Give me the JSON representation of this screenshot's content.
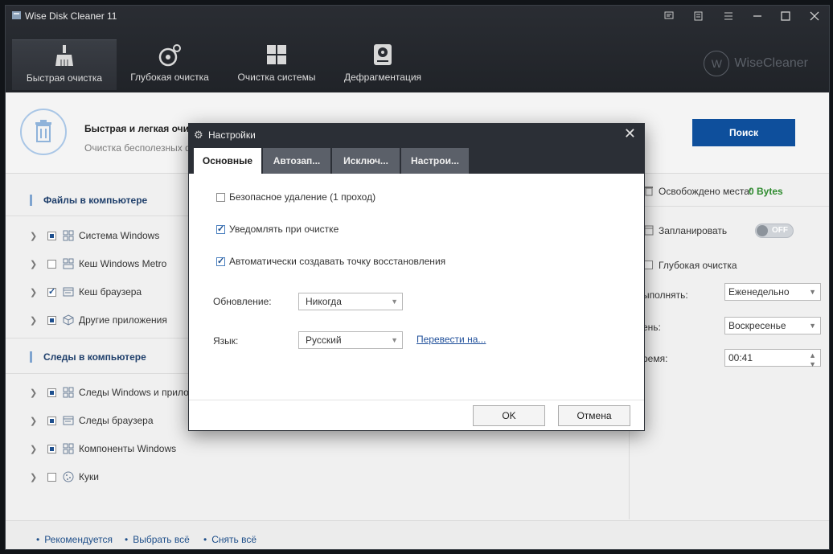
{
  "window": {
    "title": "Wise Disk Cleaner 11"
  },
  "titlebar_icons": [
    "feedback-icon",
    "notes-icon",
    "menu-icon",
    "minimize-icon",
    "maximize-icon",
    "close-icon"
  ],
  "nav": {
    "tabs": [
      {
        "label": "Быстрая очистка",
        "icon": "broom-icon"
      },
      {
        "label": "Глубокая очистка",
        "icon": "deep-clean-icon"
      },
      {
        "label": "Очистка системы",
        "icon": "windows-icon"
      },
      {
        "label": "Дефрагментация",
        "icon": "disk-icon"
      }
    ],
    "brand": "WiseCleaner",
    "brand_mark": "W"
  },
  "banner": {
    "title": "Быстрая и легкая очистка ненужных файлов и истори",
    "subtitle": "Очистка бесполезных фа",
    "scan_button": "Поиск"
  },
  "files_section": {
    "heading": "Файлы в компьютере",
    "items": [
      {
        "label": "Система Windows",
        "check": "partial"
      },
      {
        "label": "Кеш Windows Metro",
        "check": "none"
      },
      {
        "label": "Кеш браузера",
        "check": "checked"
      },
      {
        "label": "Другие приложения",
        "check": "partial"
      }
    ]
  },
  "traces_section": {
    "heading": "Следы в компьютере",
    "items": [
      {
        "label": "Следы Windows и приложен",
        "check": "partial"
      },
      {
        "label": "Следы браузера",
        "check": "partial"
      },
      {
        "label": "Компоненты Windows",
        "check": "partial"
      },
      {
        "label": "Куки",
        "check": "none"
      }
    ]
  },
  "right_panel": {
    "freed_label": "Освобождено места:",
    "freed_value": "0 Bytes",
    "schedule_label": "Запланировать",
    "toggle_text": "OFF",
    "deep_clean_label": "Глубокая очистка",
    "run_label": "ыполнять:",
    "run_value": "Еженедельно",
    "day_label": "ень:",
    "day_value": "Воскресенье",
    "time_label": "ремя:",
    "time_value": "00:41"
  },
  "footer": {
    "recommended": "Рекомендуется",
    "select_all": "Выбрать всё",
    "deselect_all": "Снять всё"
  },
  "dialog": {
    "title": "Настройки",
    "tabs": [
      "Основные",
      "Автозап...",
      "Исключ...",
      "Настрои..."
    ],
    "options": [
      {
        "label": "Безопасное удаление (1 проход)",
        "checked": false
      },
      {
        "label": "Уведомлять при очистке",
        "checked": true
      },
      {
        "label": "Автоматически создавать точку восстановления",
        "checked": true
      }
    ],
    "update_label": "Обновление:",
    "update_value": "Никогда",
    "language_label": "Язык:",
    "language_value": "Русский",
    "translate_link": "Перевести на...",
    "ok": "OK",
    "cancel": "Отмена"
  }
}
